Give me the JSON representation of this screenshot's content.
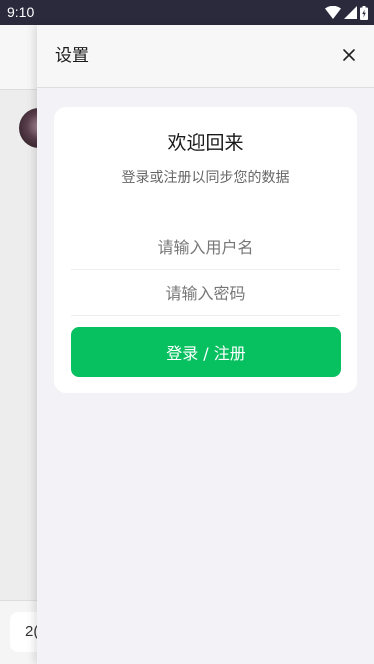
{
  "status_bar": {
    "time": "9:10",
    "icons": [
      "wifi-icon",
      "cellular-signal-icon",
      "battery-charging-icon"
    ]
  },
  "background_page": {
    "input_text": "2("
  },
  "drawer": {
    "title": "设置",
    "close_icon": "close-icon"
  },
  "login_card": {
    "title": "欢迎回来",
    "subtitle": "登录或注册以同步您的数据",
    "username_placeholder": "请输入用户名",
    "password_placeholder": "请输入密码",
    "submit_label": "登录 / 注册"
  },
  "colors": {
    "accent": "#07c160",
    "status_bar": "#2a2a3c",
    "drawer_bg": "#f2f2f7",
    "card_bg": "#ffffff"
  }
}
